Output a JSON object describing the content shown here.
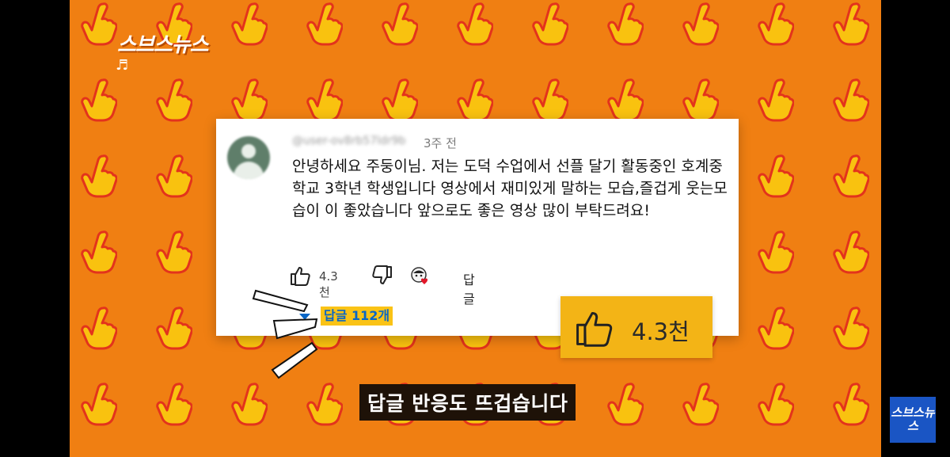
{
  "brand": {
    "logo_text": "스브스뉴스",
    "watermark_text": "스브스뉴스"
  },
  "music_note": "♬",
  "comment": {
    "username": "@user-ov8rb57ldr9b",
    "time": "3주 전",
    "text": "안녕하세요 주둥이님. 저는 도덕 수업에서 선플 달기 활동중인 호계중학교 3학년 학생입니다 영상에서 재미있게 말하는 모습,즐겁게 웃는모습이 이 좋았습니다 앞으로도 좋은 영상 많이 부탁드려요!",
    "like_count": "4.3천",
    "reply_label": "답글",
    "replies_label": "답글 112개"
  },
  "zoom": {
    "like_count": "4.3천"
  },
  "subtitle": "답글 반응도 뜨겁습니다",
  "icons": {
    "like": "thumbs-up-icon",
    "dislike": "thumbs-down-icon",
    "creator_heart": "creator-heart-icon",
    "background_hand": "pointing-hand-icon",
    "expand": "caret-down-icon"
  },
  "colors": {
    "background": "#f07f12",
    "highlight": "#f3b416",
    "reply_link": "#0866c6",
    "subtitle_bg": "#1e1208",
    "watermark_bg": "#1a55c4"
  }
}
